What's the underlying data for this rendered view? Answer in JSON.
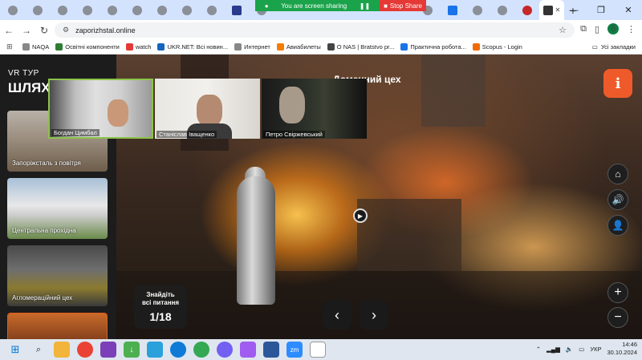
{
  "browser": {
    "address": "zaporizhstal.online",
    "share_banner": "You are screen sharing",
    "stop_share": "Stop Share",
    "bookmarks": [
      "NAQA",
      "Освітні компоненти",
      "watch",
      "UKR.NET: Всі новин...",
      "Интернет",
      "Авиабилеты",
      "О NAS | Bratstvo pr...",
      "Практична робота...",
      "Scopus - Login"
    ],
    "all_bookmarks": "Усі закладки",
    "profile_initial": "б"
  },
  "sidebar": {
    "label": "VR ТУР",
    "title": "ШЛЯХ",
    "cards": [
      "Запоріжсталь з повітря",
      "Центральна прохідна",
      "Агломераційний цех"
    ]
  },
  "scene": {
    "title": "Доменний цех",
    "quest_line1": "Знайдіть",
    "quest_line2": "всі питання",
    "quest_counter": "1/18",
    "info_glyph": "i",
    "prev_glyph": "‹",
    "next_glyph": "›"
  },
  "participants": [
    "Богдан Цимбал",
    "Станіслав Іващенко",
    "Петро Свіржевський"
  ],
  "taskbar": {
    "language": "УКР",
    "time": "14:46",
    "date": "30.10.2024"
  }
}
